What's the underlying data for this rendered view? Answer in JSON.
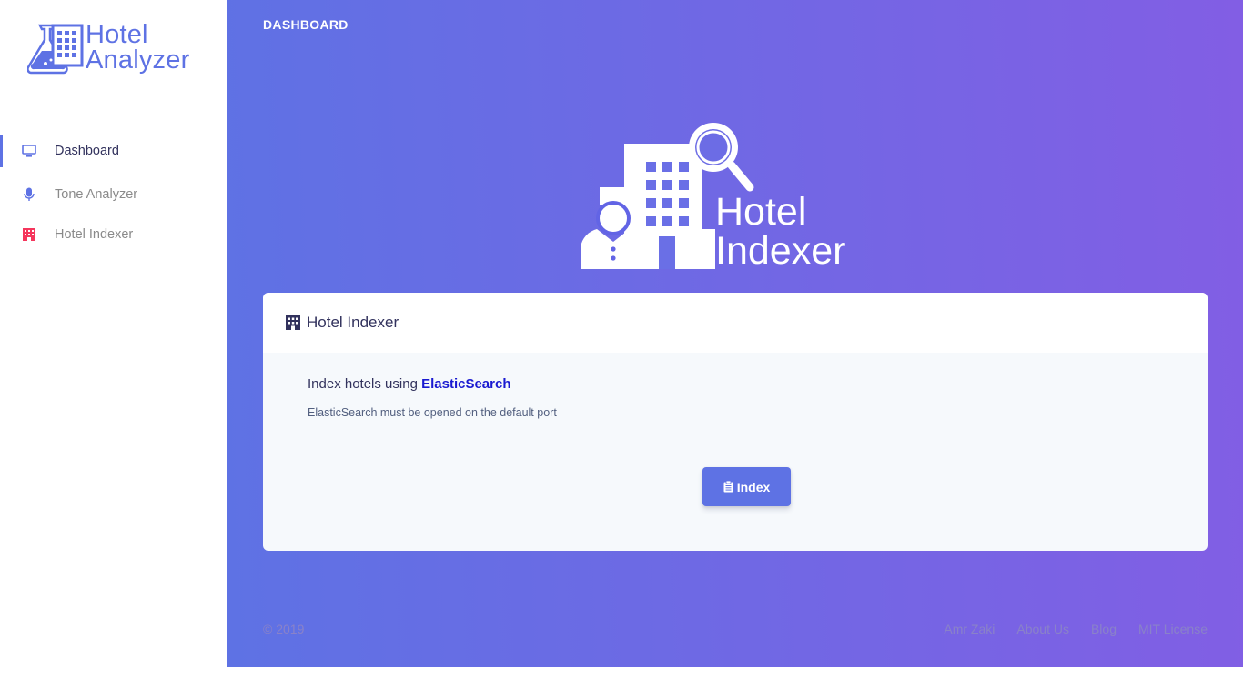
{
  "brand": {
    "line1": "Hotel",
    "line2": "Analyzer"
  },
  "sidebar": {
    "items": [
      {
        "label": "Dashboard",
        "icon": "monitor-icon",
        "active": true
      },
      {
        "label": "Tone Analyzer",
        "icon": "microphone-icon",
        "active": false
      },
      {
        "label": "Hotel Indexer",
        "icon": "hotel-icon",
        "active": false
      }
    ]
  },
  "topbar": {
    "title": "DASHBOARD"
  },
  "hero": {
    "line1": "Hotel",
    "line2": "Indexer"
  },
  "card": {
    "title": "Hotel Indexer",
    "lead_prefix": "Index hotels using ",
    "lead_link": "ElasticSearch",
    "note": "ElasticSearch must be opened on the default port",
    "button_label": "Index"
  },
  "footer": {
    "copyright": "© 2019",
    "links": [
      "Amr Zaki",
      "About Us",
      "Blog",
      "MIT License"
    ]
  },
  "colors": {
    "primary": "#5e72e4",
    "gradient_end": "#825ee4",
    "hotel_icon": "#f5365c",
    "link": "#1a1ad1"
  }
}
